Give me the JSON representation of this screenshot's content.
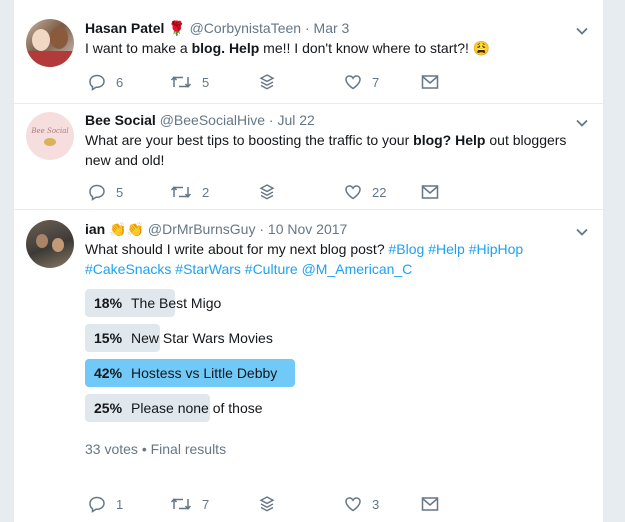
{
  "colors": {
    "accent": "#1da1f2",
    "poll_winner": "#71c9f8",
    "poll_other": "#e1e8ed",
    "muted": "#657786"
  },
  "tweets": [
    {
      "name": "Hasan Patel",
      "name_emoji": "🌹",
      "handle": "@CorbynistaTeen",
      "time": "Mar 3",
      "text_parts": [
        "I want to make a ",
        "blog.",
        " ",
        "Help",
        " me!! I don't know where to start?! ",
        "😩"
      ],
      "replies": "6",
      "retweets": "5",
      "likes": "7"
    },
    {
      "name": "Bee Social",
      "handle": "@BeeSocialHive",
      "time": "Jul 22",
      "avatar_text": "Bee Social",
      "text_parts": [
        "What are your best tips to boosting the traffic to your ",
        "blog?",
        " ",
        "Help",
        " out bloggers new and old!"
      ],
      "replies": "5",
      "retweets": "2",
      "likes": "22"
    },
    {
      "name": "ian",
      "name_emoji": "👏👏",
      "handle": "@DrMrBurnsGuy",
      "time": "10 Nov 2017",
      "text_plain": "What should I write about for my next blog post? ",
      "hashtags": [
        "#Blog",
        "#Help",
        "#HipHop",
        "#CakeSnacks",
        "#StarWars",
        "#Culture"
      ],
      "mention": "@M_American_C",
      "poll": {
        "options": [
          {
            "pct_label": "18%",
            "label": "The Best Migo",
            "pct": 18,
            "winner": false
          },
          {
            "pct_label": "15%",
            "label": "New Star Wars Movies",
            "pct": 15,
            "winner": false
          },
          {
            "pct_label": "42%",
            "label": "Hostess vs Little Debby",
            "pct": 42,
            "winner": true
          },
          {
            "pct_label": "25%",
            "label": "Please none of those",
            "pct": 25,
            "winner": false
          }
        ],
        "meta": "33 votes • Final results"
      },
      "replies": "1",
      "retweets": "7",
      "likes": "3"
    }
  ],
  "icons": [
    "reply-icon",
    "retweet-icon",
    "stack-icon",
    "like-icon",
    "message-icon",
    "chevron-down-icon"
  ]
}
